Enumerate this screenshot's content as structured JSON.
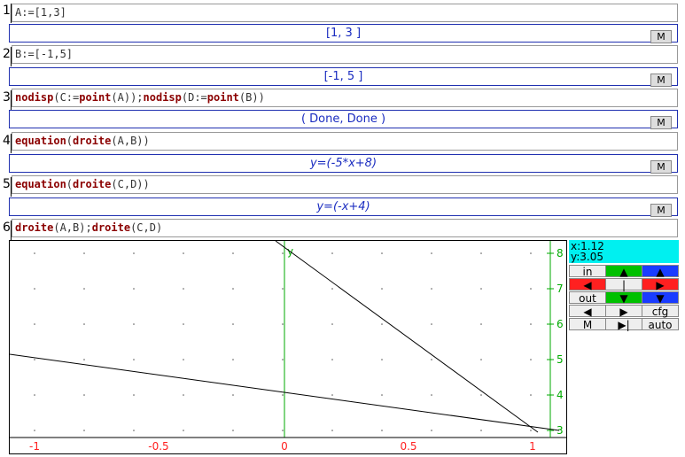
{
  "levels": [
    {
      "num": "1",
      "input": "A:=[1,3]",
      "output": "[1,  3 ]",
      "mlabel": "M"
    },
    {
      "num": "2",
      "input": "B:=[-1,5]",
      "output": "[-1,  5 ]",
      "mlabel": "M"
    },
    {
      "num": "3",
      "input_parts": [
        "nodisp",
        "(C:=",
        "point",
        "(A));",
        "nodisp",
        "(D:=",
        "point",
        "(B))"
      ],
      "output": "( Done,   Done  )",
      "mlabel": "M"
    },
    {
      "num": "4",
      "input_parts": [
        "equation",
        "(",
        "droite",
        "(A,B))"
      ],
      "output": "y=(-5*x+8)",
      "mlabel": "M"
    },
    {
      "num": "5",
      "input_parts": [
        "equation",
        "(",
        "droite",
        "(C,D))"
      ],
      "output": "y=(-x+4)",
      "mlabel": "M"
    },
    {
      "num": "6",
      "input_parts": [
        "droite",
        "(A,B);",
        "droite",
        "(C,D)"
      ]
    }
  ],
  "graph": {
    "xlabels": [
      "-1",
      "-0.5",
      "0",
      "0.5",
      "1"
    ],
    "ylabels": [
      "8",
      "7",
      "6",
      "5",
      "4",
      "3"
    ],
    "ylabel": "y"
  },
  "panel": {
    "x": "x:1.12",
    "y": "y:3.05",
    "buttons": {
      "in": "in",
      "out": "out",
      "cfg": "cfg",
      "m": "M",
      "auto": "auto",
      "bar": "|"
    }
  }
}
